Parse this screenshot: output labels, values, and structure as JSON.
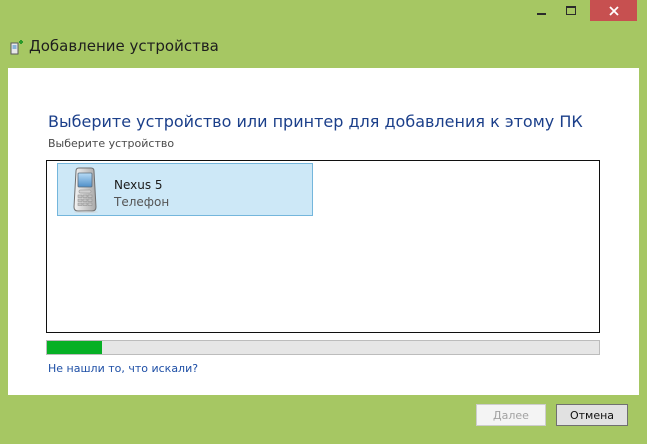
{
  "window": {
    "title": "Добавление устройства",
    "accent_color": "#a6c763",
    "controls": [
      "minimize-icon",
      "maximize-icon",
      "close-icon"
    ]
  },
  "main": {
    "heading": "Выберите устройство или принтер для добавления к этому ПК",
    "subheading": "Выберите устройство",
    "devices": [
      {
        "name": "Nexus 5",
        "type": "Телефон",
        "icon": "phone-icon"
      }
    ],
    "progress": {
      "value": 0.1,
      "color": "#06b025"
    },
    "help_link": "Не нашли то, что искали?"
  },
  "footer": {
    "next_label": "Далее",
    "cancel_label": "Отмена"
  }
}
